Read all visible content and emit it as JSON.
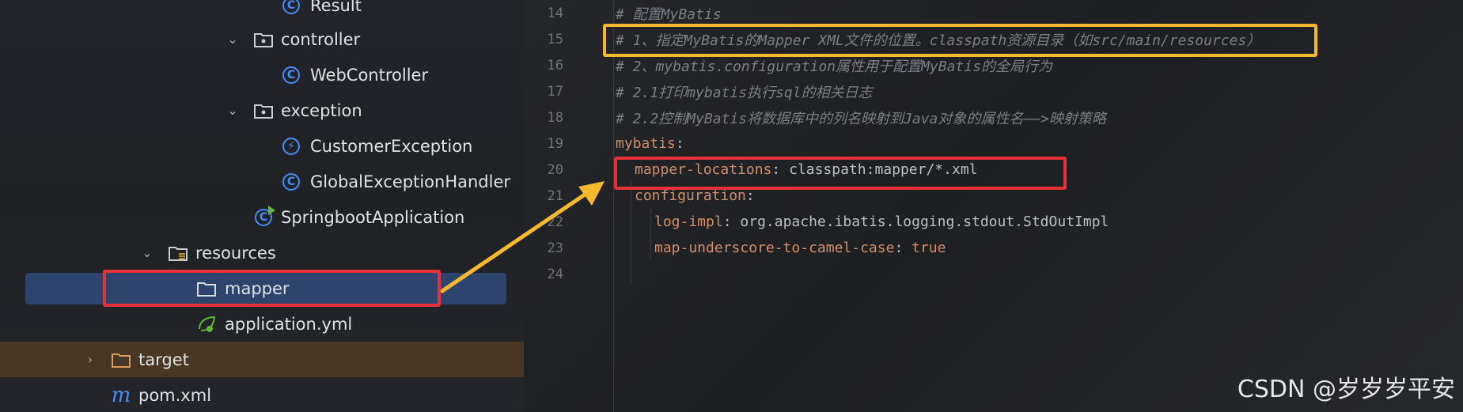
{
  "tree": {
    "items": [
      {
        "label": "Result",
        "icon": "class-icon",
        "expanded": null
      },
      {
        "label": "controller",
        "icon": "package-folder-icon",
        "expanded": true
      },
      {
        "label": "WebController",
        "icon": "class-icon",
        "expanded": null
      },
      {
        "label": "exception",
        "icon": "package-folder-icon",
        "expanded": true
      },
      {
        "label": "CustomerException",
        "icon": "exception-class-icon",
        "expanded": null
      },
      {
        "label": "GlobalExceptionHandler",
        "icon": "class-icon",
        "expanded": null
      },
      {
        "label": "SpringbootApplication",
        "icon": "spring-boot-class-icon",
        "expanded": null
      },
      {
        "label": "resources",
        "icon": "resources-folder-icon",
        "expanded": true
      },
      {
        "label": "mapper",
        "icon": "folder-icon",
        "expanded": null,
        "selected": true
      },
      {
        "label": "application.yml",
        "icon": "spring-yaml-icon",
        "expanded": null
      },
      {
        "label": "target",
        "icon": "excluded-folder-icon",
        "expanded": false
      },
      {
        "label": "pom.xml",
        "icon": "maven-icon",
        "expanded": null
      }
    ]
  },
  "editor": {
    "lines": [
      {
        "num": "14",
        "text": "# 配置MyBatis"
      },
      {
        "num": "15",
        "text": "# 1、指定MyBatis的Mapper XML文件的位置。classpath资源目录（如src/main/resources）"
      },
      {
        "num": "16",
        "text": "# 2、mybatis.configuration属性用于配置MyBatis的全局行为"
      },
      {
        "num": "17",
        "text": "# 2.1打印mybatis执行sql的相关日志"
      },
      {
        "num": "18",
        "text": "# 2.2控制MyBatis将数据库中的列名映射到Java对象的属性名——>映射策略"
      },
      {
        "num": "19",
        "key": "mybatis",
        "sep": ":",
        "value": ""
      },
      {
        "num": "20",
        "key": "mapper-locations",
        "sep": ": ",
        "value": "classpath:mapper/*.xml"
      },
      {
        "num": "21",
        "key": "configuration",
        "sep": ":",
        "value": ""
      },
      {
        "num": "22",
        "key": "log-impl",
        "sep": ": ",
        "value": "org.apache.ibatis.logging.stdout.StdOutImpl"
      },
      {
        "num": "23",
        "key": "map-underscore-to-camel-case",
        "sep": ": ",
        "value": "true"
      },
      {
        "num": "24",
        "text": ""
      }
    ]
  },
  "colors": {
    "comment": "#7a7e85",
    "yaml_key": "#cf8e6d",
    "yaml_value": "#bcbec4",
    "selection": "#2e436e",
    "annotation_yellow": "#f5b82e",
    "annotation_red": "#e8303a"
  },
  "watermark": "CSDN @岁岁岁平安"
}
